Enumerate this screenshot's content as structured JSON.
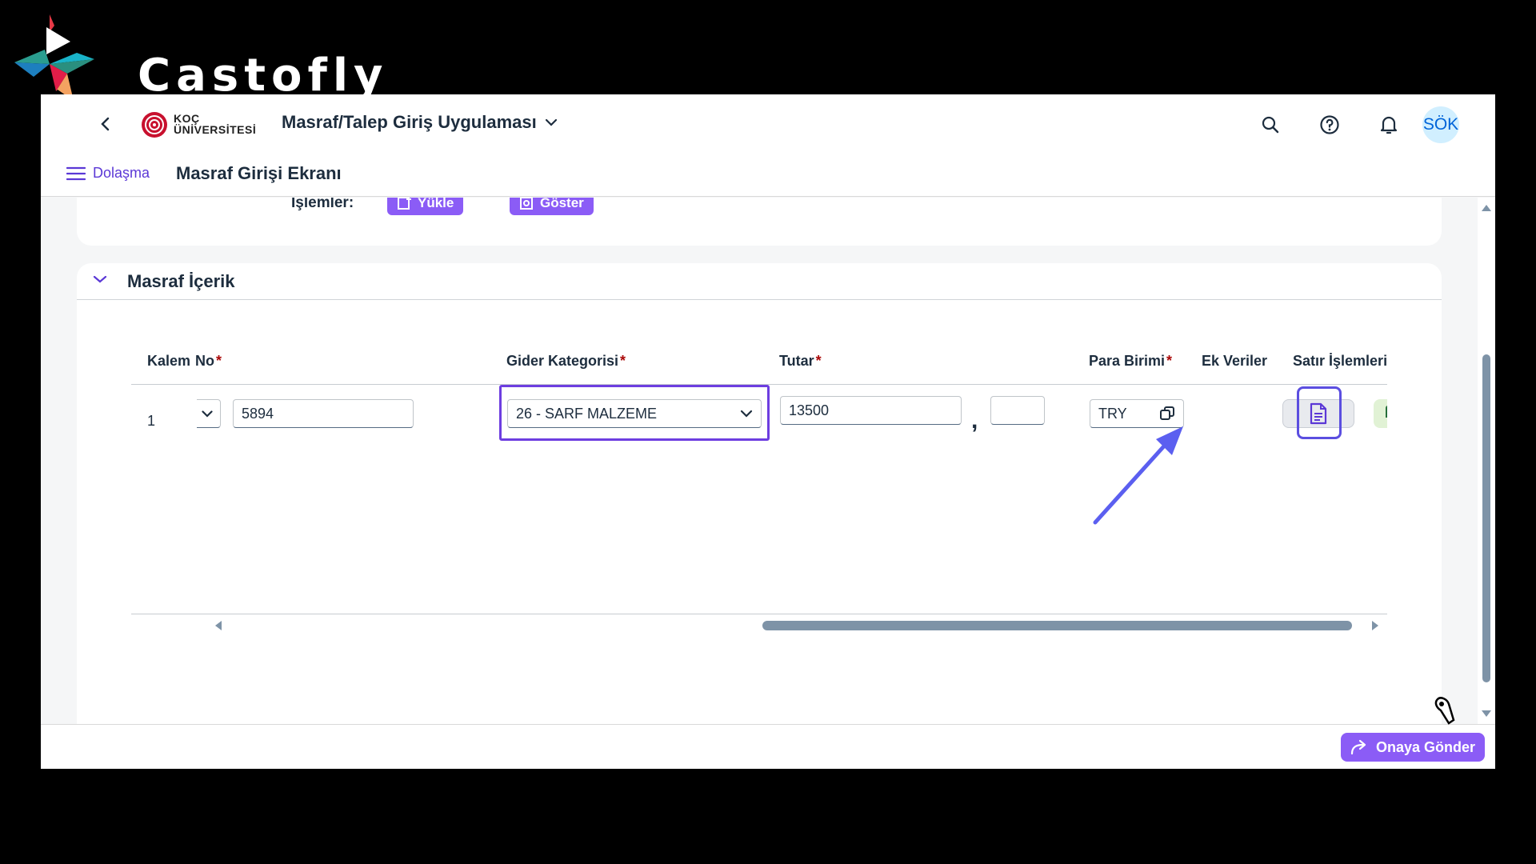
{
  "brand": {
    "name": "Castofly"
  },
  "shellbar": {
    "org_line1": "KOÇ",
    "org_line2": "ÜNİVERSİTESİ",
    "app_title": "Masraf/Talep Giriş Uygulaması",
    "avatar_initials": "SÖK"
  },
  "subbar": {
    "nav_label": "Dolaşma",
    "page_title": "Masraf Girişi Ekranı"
  },
  "top_section": {
    "ops_label": "İşlemler:",
    "upload_label": "Yükle",
    "show_label": "Göster"
  },
  "section": {
    "title": "Masraf İçerik"
  },
  "table": {
    "headers": {
      "kalem": "Kalem",
      "no": "No",
      "gider": "Gider Kategorisi",
      "tutar": "Tutar",
      "para": "Para Birimi",
      "ek": "Ek Veriler",
      "satir": "Satır İşlemleri"
    },
    "row": {
      "kalem": "1",
      "no_value": "5894",
      "gider_value": "26 - SARF MALZEME",
      "tutar_value": "13500",
      "decimal_sep": ",",
      "decimal_value": "",
      "para_value": "TRY"
    }
  },
  "footer": {
    "submit_label": "Onaya Gönder"
  },
  "colors": {
    "accent": "#8b5cf6",
    "focus": "#6d3ee0",
    "annotation_arrow": "#5b5ff0",
    "copy_btn_bg": "#e1f2d5",
    "delete_btn_bg": "#fde4ea"
  }
}
